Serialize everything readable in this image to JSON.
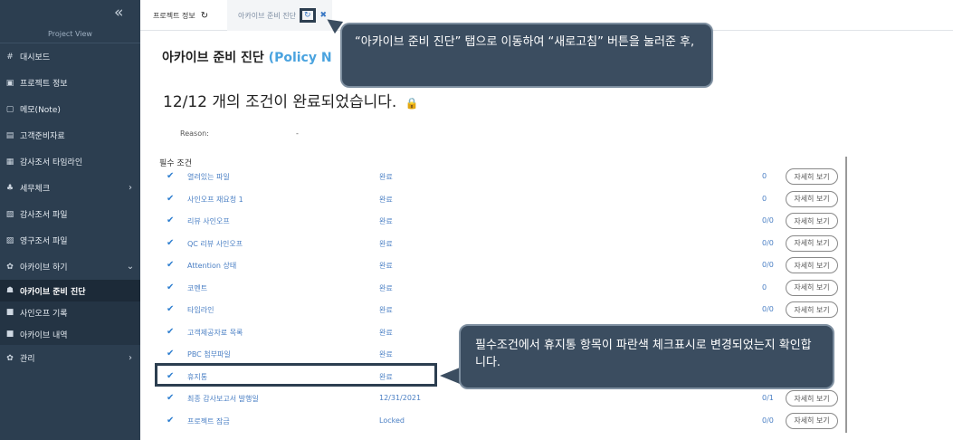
{
  "sidebar": {
    "collapse_icon": "«",
    "project_view": "Project View",
    "items": [
      {
        "icon": "#",
        "label": "대시보드",
        "chevron": ""
      },
      {
        "icon": "▣",
        "label": "프로젝트 정보",
        "chevron": ""
      },
      {
        "icon": "▢",
        "label": "메모(Note)",
        "chevron": ""
      },
      {
        "icon": "▤",
        "label": "고객준비자료",
        "chevron": ""
      },
      {
        "icon": "▦",
        "label": "감사조서 타임라인",
        "chevron": ""
      },
      {
        "icon": "♣",
        "label": "세무체크",
        "chevron": "›"
      },
      {
        "icon": "▧",
        "label": "감사조서 파일",
        "chevron": ""
      },
      {
        "icon": "▨",
        "label": "영구조서 파일",
        "chevron": ""
      },
      {
        "icon": "✿",
        "label": "아카이브 하기",
        "chevron": "⌄"
      },
      {
        "icon": "☗",
        "label": "아카이브 준비 진단",
        "chevron": ""
      },
      {
        "icon": "■",
        "label": "사인오프 기록",
        "chevron": ""
      },
      {
        "icon": "■",
        "label": "아카이브 내역",
        "chevron": ""
      },
      {
        "icon": "✿",
        "label": "관리",
        "chevron": "›"
      }
    ]
  },
  "tabs": {
    "tab1_label": "프로젝트 정보",
    "tab1_reload": "↻",
    "tab2_label": "아카이브 준비 진단",
    "tab2_reload": "↻",
    "tab2_close": "✖"
  },
  "main": {
    "title": "아카이브 준비 진단",
    "title_sub": "(Policy N",
    "status": "12/12 개의 조건이 완료되었습니다.",
    "reason_label": "Reason:",
    "reason_value": "-",
    "section_title": "필수 조건",
    "detail_label": "자세히 보기",
    "rows": [
      {
        "name": "열려있는 파일",
        "status": "완료",
        "count": "0",
        "has_detail": true
      },
      {
        "name": "사인오프 재요청 1",
        "status": "완료",
        "count": "0",
        "has_detail": true
      },
      {
        "name": "리뷰 사인오프",
        "status": "완료",
        "count": "0/0",
        "has_detail": true
      },
      {
        "name": "QC 리뷰 사인오프",
        "status": "완료",
        "count": "0/0",
        "has_detail": true
      },
      {
        "name": "Attention 상태",
        "status": "완료",
        "count": "0/0",
        "has_detail": true
      },
      {
        "name": "코멘트",
        "status": "완료",
        "count": "0",
        "has_detail": true
      },
      {
        "name": "타임라인",
        "status": "완료",
        "count": "0/0",
        "has_detail": true
      },
      {
        "name": "고객제공자료 목록",
        "status": "완료",
        "count": "",
        "has_detail": false
      },
      {
        "name": "PBC 첨부파일",
        "status": "완료",
        "count": "",
        "has_detail": false
      },
      {
        "name": "휴지통",
        "status": "완료",
        "count": "",
        "has_detail": false
      },
      {
        "name": "최종 감사보고서 발행일",
        "status": "12/31/2021",
        "count": "0/1",
        "has_detail": true
      },
      {
        "name": "프로젝트 잠금",
        "status": "Locked",
        "count": "0/0",
        "has_detail": true
      }
    ]
  },
  "callouts": {
    "top": "“아카이브 준비 진단” 탭으로 이동하여 “새로고침” 버튼을 눌러준 후,",
    "bottom": "필수조건에서 휴지통 항목이 파란색 체크표시로 변경되었는지 확인합니다."
  },
  "colors": {
    "sidebar_bg": "#2c3e50",
    "accent_blue": "#4aa3df",
    "check_blue": "#2f7fd0",
    "lock_orange": "#f0a020",
    "callout_bg": "#3b4d60"
  }
}
